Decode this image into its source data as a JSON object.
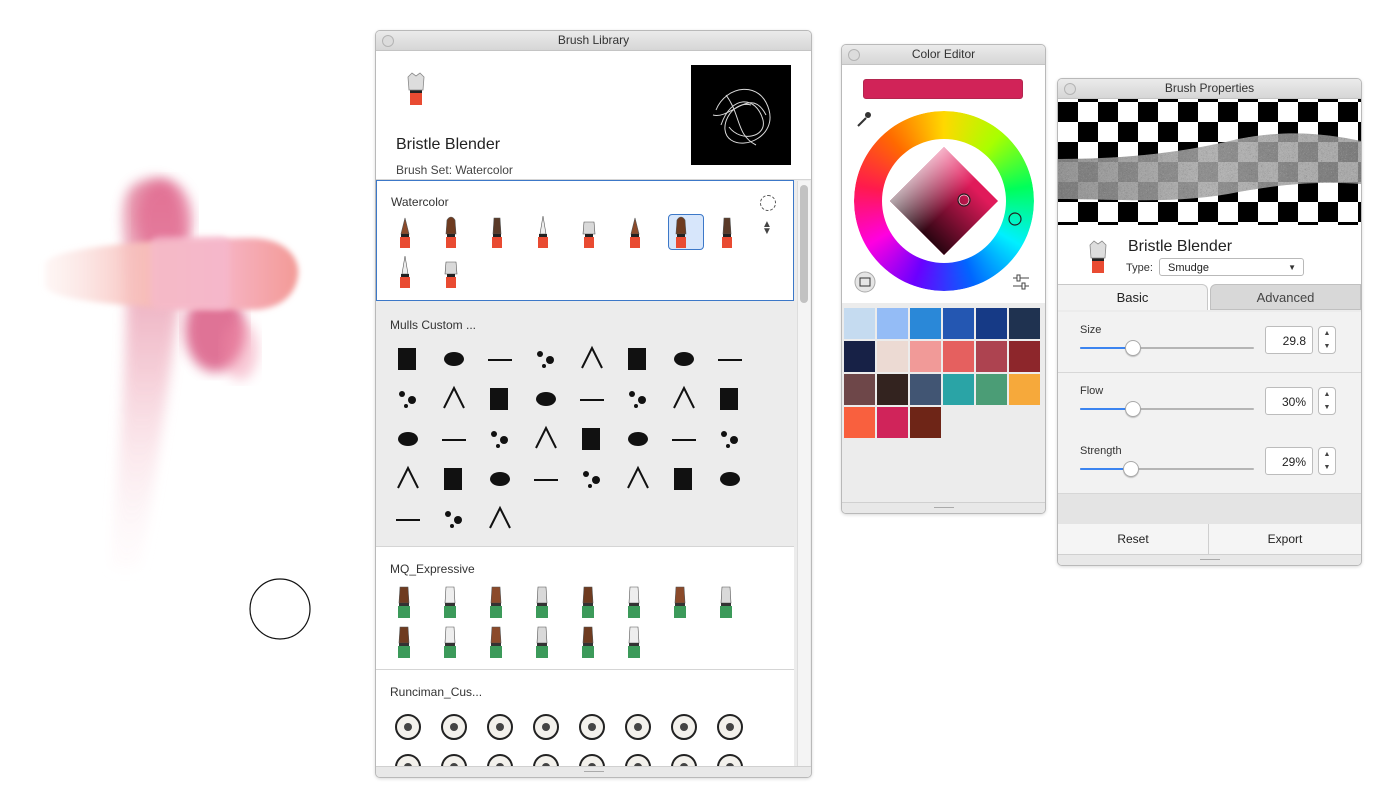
{
  "brush_library": {
    "title": "Brush Library",
    "current_brush": "Bristle Blender",
    "brush_set": "Brush Set: Watercolor",
    "sections": [
      {
        "title": "Watercolor"
      },
      {
        "title": "Mulls Custom ..."
      },
      {
        "title": "MQ_Expressive"
      },
      {
        "title": "Runciman_Cus..."
      }
    ]
  },
  "color_editor": {
    "title": "Color Editor",
    "current_color": "#d12358",
    "swatches": [
      "#c5dbf0",
      "#94bcf6",
      "#2a88d8",
      "#2457b2",
      "#163a86",
      "#1f3250",
      "#172146",
      "#ecdad3",
      "#f19a98",
      "#e5605f",
      "#ad4350",
      "#8d262b",
      "#6e4749",
      "#33231f",
      "#415573",
      "#2aa4a6",
      "#4b9d76",
      "#f6a93b",
      "#f9603e",
      "#d0245a",
      "#6e2517"
    ]
  },
  "brush_properties": {
    "title": "Brush Properties",
    "brush_name": "Bristle Blender",
    "type_label": "Type:",
    "type_value": "Smudge",
    "tabs": {
      "basic": "Basic",
      "advanced": "Advanced"
    },
    "size": {
      "label": "Size",
      "value": "29.8",
      "level": 0.3
    },
    "flow": {
      "label": "Flow",
      "value": "30%",
      "level": 0.3
    },
    "strength": {
      "label": "Strength",
      "value": "29%",
      "level": 0.29
    },
    "reset_label": "Reset",
    "export_label": "Export"
  }
}
